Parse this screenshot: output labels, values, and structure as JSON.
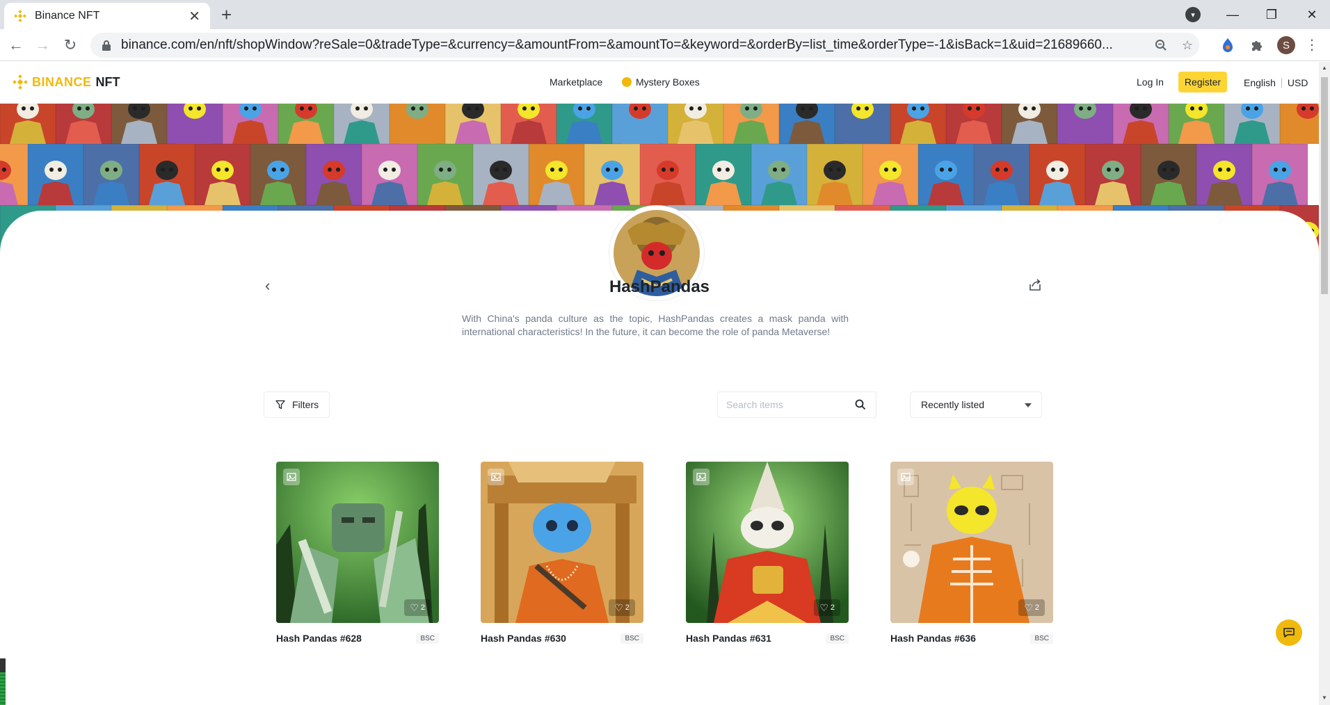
{
  "browser": {
    "tab_title": "Binance NFT",
    "url": "binance.com/en/nft/shopWindow?reSale=0&tradeType=&currency=&amountFrom=&amountTo=&keyword=&orderBy=list_time&orderType=-1&isBack=1&uid=21689660...",
    "profile_initial": "S"
  },
  "header": {
    "logo_brand": "BINANCE",
    "logo_product": "NFT",
    "nav": [
      "Marketplace",
      "Mystery Boxes"
    ],
    "login": "Log In",
    "register": "Register",
    "language": "English",
    "currency": "USD"
  },
  "collection": {
    "title": "HashPandas",
    "description": "With China's panda culture as the topic, HashPandas creates a mask panda with international characteristics! In the future, it can become the role of panda Metaverse!"
  },
  "controls": {
    "filters_label": "Filters",
    "search_placeholder": "Search items",
    "sort_value": "Recently listed"
  },
  "items": [
    {
      "name": "Hash Pandas #628",
      "chain": "BSC",
      "likes": "2"
    },
    {
      "name": "Hash Pandas #630",
      "chain": "BSC",
      "likes": "2"
    },
    {
      "name": "Hash Pandas #631",
      "chain": "BSC",
      "likes": "2"
    },
    {
      "name": "Hash Pandas #636",
      "chain": "BSC",
      "likes": "2"
    }
  ],
  "colors": {
    "accent": "#f0b90b",
    "register_bg": "#fcd535"
  }
}
